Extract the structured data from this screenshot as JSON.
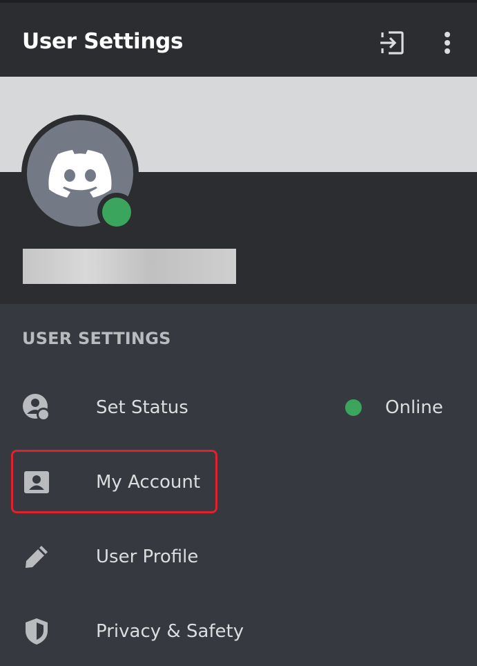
{
  "header": {
    "title": "User Settings",
    "logout_icon": "logout-icon",
    "more_icon": "more-vertical-icon"
  },
  "profile": {
    "avatar_icon": "discord-logo-icon",
    "status_color": "#3ba55d",
    "username_redacted": true
  },
  "settings": {
    "section_title": "USER SETTINGS",
    "items": [
      {
        "label": "Set Status",
        "icon": "status-icon",
        "value": "Online",
        "value_color": "#3ba55d"
      },
      {
        "label": "My Account",
        "icon": "account-card-icon",
        "highlighted": true
      },
      {
        "label": "User Profile",
        "icon": "pencil-icon"
      },
      {
        "label": "Privacy & Safety",
        "icon": "shield-icon"
      }
    ]
  },
  "colors": {
    "background": "#36393f",
    "header_bg": "#2b2d31",
    "banner": "#d6d8da",
    "avatar_bg": "#737a86",
    "highlight": "#e0212e"
  }
}
